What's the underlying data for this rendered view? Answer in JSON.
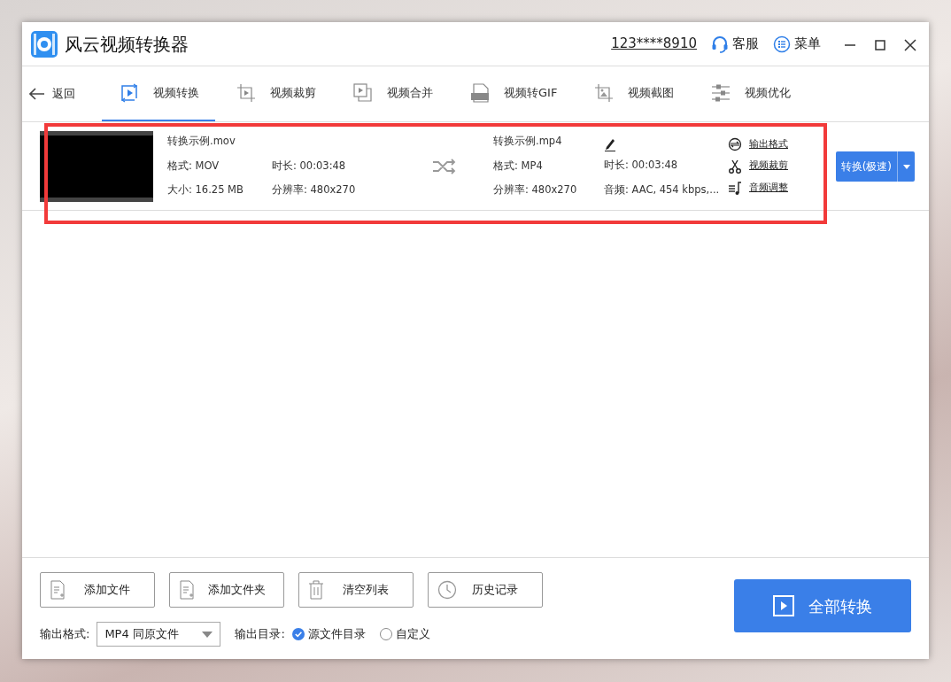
{
  "window": {
    "title": "风云视频转换器"
  },
  "account": "123****8910",
  "header_actions": [
    {
      "kind": "support",
      "label": "客服"
    },
    {
      "kind": "menu",
      "label": "菜单"
    }
  ],
  "back": "返回",
  "tabs": [
    {
      "kind": "convert",
      "label": "视频转换",
      "selected": true
    },
    {
      "kind": "crop",
      "label": "视频裁剪",
      "selected": false
    },
    {
      "kind": "merge",
      "label": "视频合并",
      "selected": false
    },
    {
      "kind": "gif",
      "label": "视频转GIF",
      "selected": false
    },
    {
      "kind": "screenshot",
      "label": "视频截图",
      "selected": false
    },
    {
      "kind": "optimize",
      "label": "视频优化",
      "selected": false
    }
  ],
  "files": [
    {
      "source": {
        "name": "转换示例.mov",
        "format": "格式: MOV",
        "duration": "时长: 00:03:48",
        "size": "大小: 16.25 MB",
        "resolution": "分辨率: 480x270"
      },
      "output": {
        "name": "转换示例.mp4",
        "format": "格式: MP4",
        "duration": "时长: 00:03:48",
        "resolution": "分辨率: 480x270",
        "audio": "音频: AAC, 454 kbps,..."
      },
      "links": [
        {
          "kind": "format",
          "label": "输出格式"
        },
        {
          "kind": "cut",
          "label": "视频裁剪"
        },
        {
          "kind": "audio",
          "label": "音频调整"
        }
      ],
      "convert_button": "转换(极速)"
    }
  ],
  "toolbar": [
    {
      "kind": "add-file",
      "label": "添加文件"
    },
    {
      "kind": "add-folder",
      "label": "添加文件夹"
    },
    {
      "kind": "clear",
      "label": "清空列表"
    },
    {
      "kind": "history",
      "label": "历史记录"
    }
  ],
  "output_format": {
    "label": "输出格式:",
    "value": "MP4 同原文件"
  },
  "output_dir": {
    "label": "输出目录:",
    "options": [
      {
        "label": "源文件目录",
        "selected": true
      },
      {
        "label": "自定义",
        "selected": false
      }
    ]
  },
  "convert_all": "全部转换"
}
